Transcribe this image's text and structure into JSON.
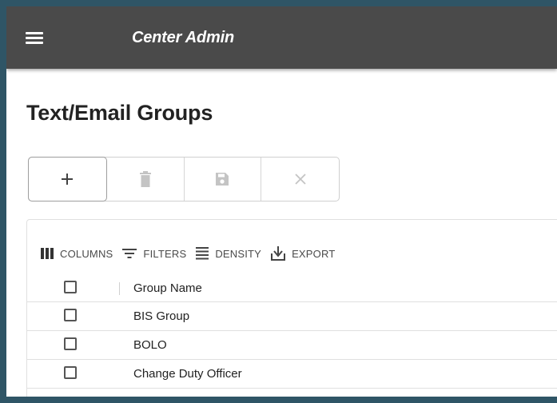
{
  "appbar": {
    "title": "Center Admin",
    "background": "#4a4a4a"
  },
  "page": {
    "title": "Text/Email Groups"
  },
  "toolbar_buttons": [
    {
      "icon": "plus-icon",
      "enabled": true
    },
    {
      "icon": "trash-icon",
      "enabled": false
    },
    {
      "icon": "save-icon",
      "enabled": false
    },
    {
      "icon": "close-icon",
      "enabled": false
    }
  ],
  "grid_toolbar": {
    "columns_label": "COLUMNS",
    "filters_label": "FILTERS",
    "density_label": "DENSITY",
    "export_label": "EXPORT"
  },
  "table": {
    "header": "Group Name",
    "rows": [
      {
        "name": "BIS Group"
      },
      {
        "name": "BOLO"
      },
      {
        "name": "Change Duty Officer"
      }
    ]
  },
  "colors": {
    "outer_border": "#2f5566",
    "icon_enabled": "#424242",
    "icon_disabled": "#c4c4c4"
  }
}
